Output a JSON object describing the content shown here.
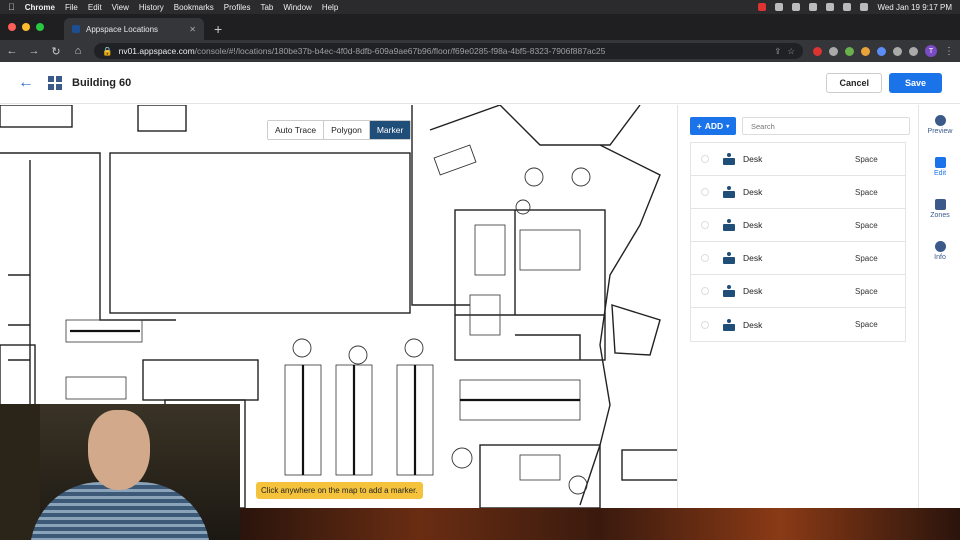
{
  "mac_menu": {
    "app": "Chrome",
    "items": [
      "File",
      "Edit",
      "View",
      "History",
      "Bookmarks",
      "Profiles",
      "Tab",
      "Window",
      "Help"
    ],
    "clock": "Wed Jan 19  9:17 PM"
  },
  "browser": {
    "tab_title": "Appspace Locations",
    "url_host": "nv01.appspace.com",
    "url_path": "/console/#!/locations/180be37b-b4ec-4f0d-8dfb-609a9ae67b96/floor/f69e0285-f98a-4bf5-8323-7906f887ac25",
    "profile_initial": "T"
  },
  "header": {
    "title": "Building 60",
    "cancel_label": "Cancel",
    "save_label": "Save"
  },
  "map_toolbar": {
    "auto_trace": "Auto Trace",
    "polygon": "Polygon",
    "marker": "Marker",
    "active": "Marker"
  },
  "hint": "Click anywhere on the map to add a marker.",
  "panel": {
    "add_label": "ADD",
    "search_placeholder": "Search",
    "items": [
      {
        "name": "Desk",
        "type": "Space"
      },
      {
        "name": "Desk",
        "type": "Space"
      },
      {
        "name": "Desk",
        "type": "Space"
      },
      {
        "name": "Desk",
        "type": "Space"
      },
      {
        "name": "Desk",
        "type": "Space"
      },
      {
        "name": "Desk",
        "type": "Space"
      }
    ]
  },
  "rail": {
    "preview": "Preview",
    "edit": "Edit",
    "zones": "Zones",
    "info": "Info",
    "active": "Edit"
  },
  "colors": {
    "primary": "#1a73e8",
    "toolbar_active": "#1f4e79",
    "hint_bg": "#f5c33b"
  }
}
